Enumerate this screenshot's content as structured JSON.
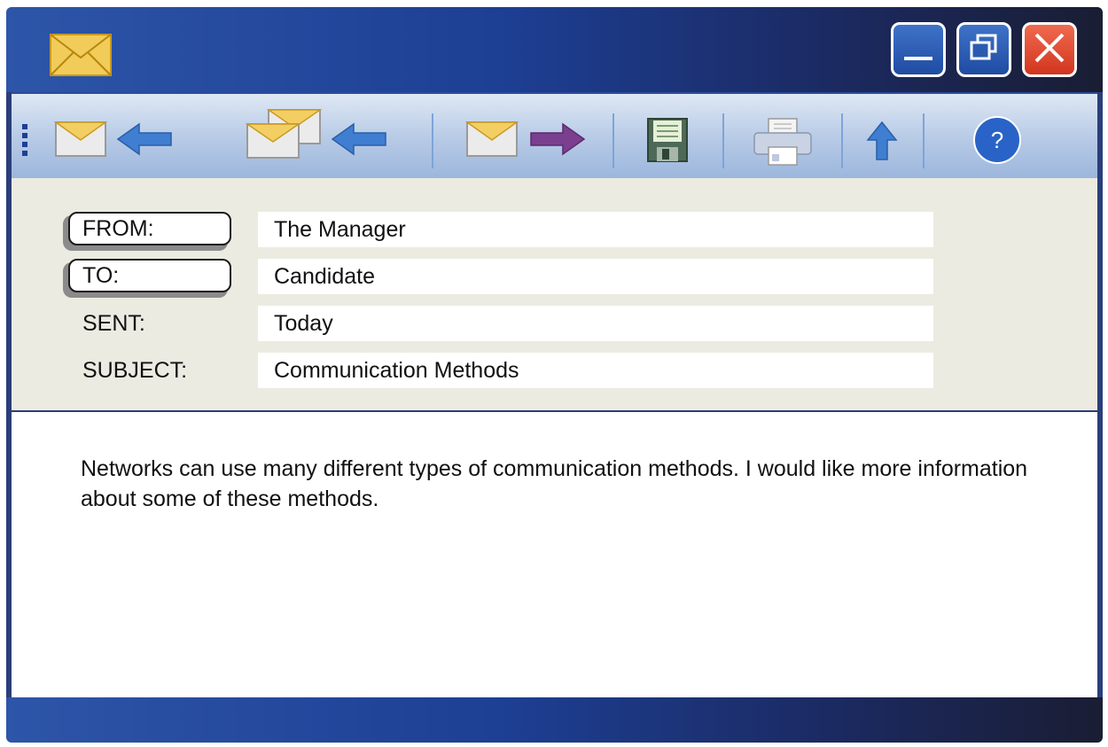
{
  "window": {
    "app_icon": "envelope-icon",
    "controls": [
      "minimize-icon",
      "restore-icon",
      "close-icon"
    ]
  },
  "toolbar": {
    "items": [
      {
        "name": "reply",
        "icon": "reply-icon"
      },
      {
        "name": "reply-all",
        "icon": "reply-all-icon"
      },
      {
        "name": "forward",
        "icon": "forward-icon"
      },
      {
        "name": "save",
        "icon": "floppy-disk-icon"
      },
      {
        "name": "print",
        "icon": "printer-icon"
      },
      {
        "name": "upload",
        "icon": "up-arrow-icon"
      },
      {
        "name": "help",
        "icon": "help-icon",
        "glyph": "?"
      }
    ]
  },
  "header": {
    "from_label": "FROM:",
    "from_value": "The Manager",
    "to_label": "TO:",
    "to_value": "Candidate",
    "sent_label": "SENT:",
    "sent_value": "Today",
    "subject_label": "SUBJECT:",
    "subject_value": "Communication Methods"
  },
  "message": {
    "body": "Networks can use many different types of communication methods. I would like more information about some of these methods."
  },
  "colors": {
    "titlebar": "#1d3f94",
    "toolbar": "#b9cce7",
    "header_pane": "#ecebe1",
    "close_button": "#d2351e"
  }
}
